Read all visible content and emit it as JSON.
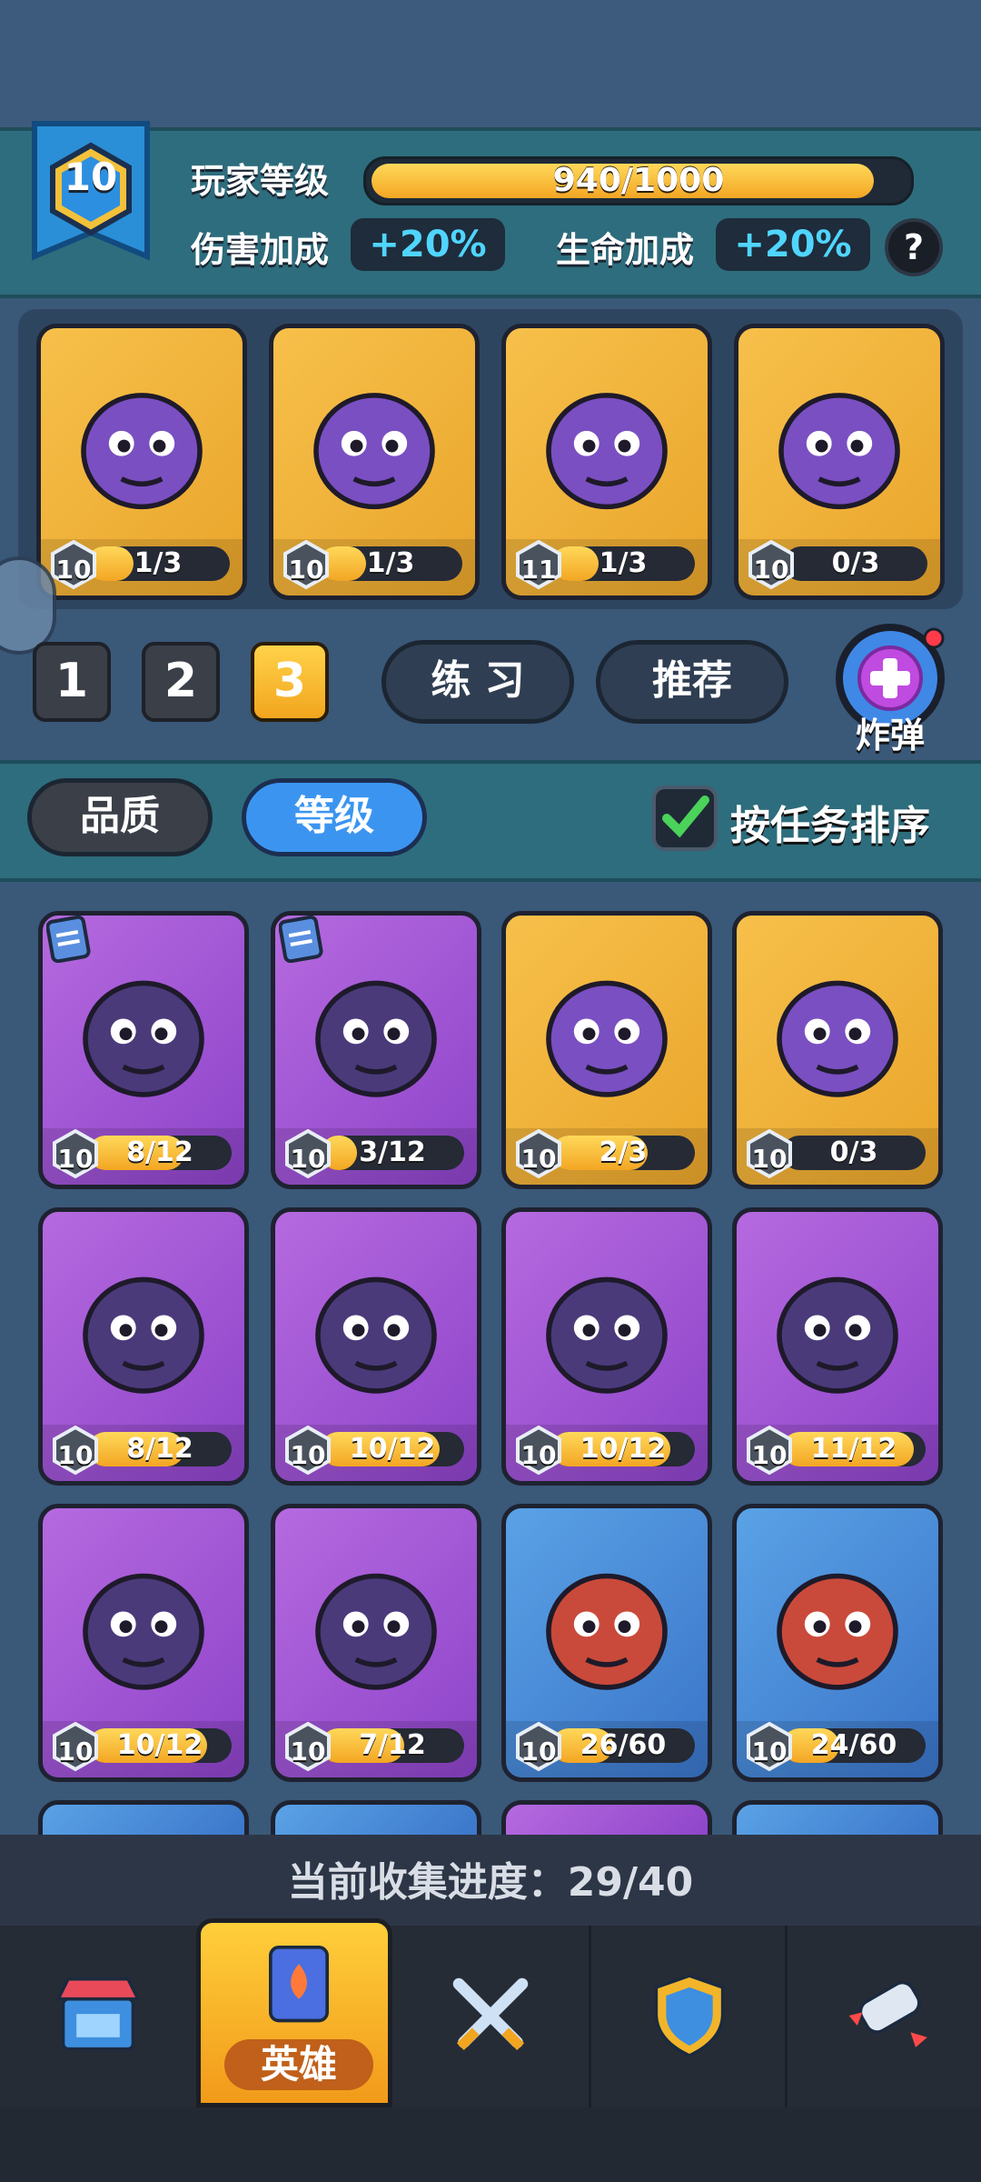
{
  "player": {
    "level": "10",
    "level_label": "玩家等级",
    "xp_text": "940/1000",
    "xp_progress": 0.94,
    "damage_label": "伤害加成",
    "damage_value": "+20%",
    "hp_label": "生命加成",
    "hp_value": "+20%",
    "help_icon": "?"
  },
  "team": [
    {
      "level": "10",
      "progress": "1/3",
      "fill": 0.33,
      "rarity": "gold",
      "icon": "spider-hero-icon"
    },
    {
      "level": "10",
      "progress": "1/3",
      "fill": 0.33,
      "rarity": "gold",
      "icon": "cat-hero-icon"
    },
    {
      "level": "11",
      "progress": "1/3",
      "fill": 0.33,
      "rarity": "gold",
      "icon": "vampire-hero-icon"
    },
    {
      "level": "10",
      "progress": "0/3",
      "fill": 0,
      "rarity": "gold",
      "icon": "bat-hero-icon"
    }
  ],
  "deck_tabs": [
    "1",
    "2",
    "3"
  ],
  "selected_deck": "3",
  "practice_label": "练 习",
  "recommend_label": "推荐",
  "bomb_label": "炸弹",
  "filters": {
    "quality_label": "品质",
    "level_label": "等级",
    "sort_label": "按任务排序",
    "sort_checked": true
  },
  "heroes": [
    {
      "level": "10",
      "progress": "8/12",
      "fill": 0.67,
      "rarity": "purple",
      "task": true,
      "icon": "fire-hero-icon"
    },
    {
      "level": "10",
      "progress": "3/12",
      "fill": 0.25,
      "rarity": "purple",
      "task": true,
      "icon": "minotaur-hero-icon"
    },
    {
      "level": "10",
      "progress": "2/3",
      "fill": 0.67,
      "rarity": "gold",
      "task": false,
      "icon": "rooster-hero-icon"
    },
    {
      "level": "10",
      "progress": "0/3",
      "fill": 0,
      "rarity": "gold",
      "task": false,
      "icon": "masked-hero-icon"
    },
    {
      "level": "10",
      "progress": "8/12",
      "fill": 0.67,
      "rarity": "purple",
      "task": false,
      "icon": "orc-hero-icon"
    },
    {
      "level": "10",
      "progress": "10/12",
      "fill": 0.83,
      "rarity": "purple",
      "task": false,
      "icon": "yeti-hero-icon"
    },
    {
      "level": "10",
      "progress": "10/12",
      "fill": 0.83,
      "rarity": "purple",
      "task": false,
      "icon": "slime-hero-icon"
    },
    {
      "level": "10",
      "progress": "11/12",
      "fill": 0.92,
      "rarity": "purple",
      "task": false,
      "icon": "ninja-hero-icon"
    },
    {
      "level": "10",
      "progress": "10/12",
      "fill": 0.83,
      "rarity": "purple",
      "task": false,
      "icon": "tiger-hero-icon"
    },
    {
      "level": "10",
      "progress": "7/12",
      "fill": 0.58,
      "rarity": "purple",
      "task": false,
      "icon": "ice-queen-hero-icon"
    },
    {
      "level": "10",
      "progress": "26/60",
      "fill": 0.43,
      "rarity": "blue",
      "task": false,
      "icon": "viking-hero-icon"
    },
    {
      "level": "10",
      "progress": "24/60",
      "fill": 0.4,
      "rarity": "blue",
      "task": false,
      "icon": "birds-hero-icon"
    }
  ],
  "collection": {
    "label": "当前收集进度：29/40"
  },
  "nav": [
    {
      "icon": "shop-icon",
      "label": ""
    },
    {
      "icon": "hero-card-icon",
      "label": "英雄",
      "active": true
    },
    {
      "icon": "crossed-swords-icon",
      "label": ""
    },
    {
      "icon": "guild-shield-icon",
      "label": ""
    },
    {
      "icon": "gauntlet-icon",
      "label": ""
    }
  ]
}
